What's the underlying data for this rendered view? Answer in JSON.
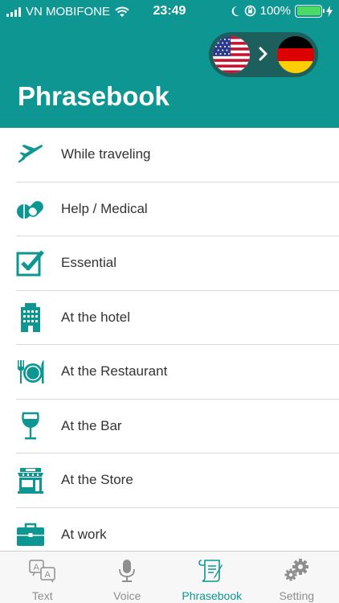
{
  "status_bar": {
    "carrier": "VN MOBIFONE",
    "time": "23:49",
    "battery": "100%"
  },
  "language_switch": {
    "from_flag": "us-flag-icon",
    "to_flag": "germany-flag-icon"
  },
  "header": {
    "title": "Phrasebook"
  },
  "categories": [
    {
      "label": "While traveling",
      "icon": "airplane-icon"
    },
    {
      "label": "Help / Medical",
      "icon": "pills-icon"
    },
    {
      "label": "Essential",
      "icon": "checkbox-icon"
    },
    {
      "label": "At the hotel",
      "icon": "hotel-icon"
    },
    {
      "label": "At the Restaurant",
      "icon": "restaurant-icon"
    },
    {
      "label": "At the Bar",
      "icon": "wine-glass-icon"
    },
    {
      "label": "At the Store",
      "icon": "store-icon"
    },
    {
      "label": "At work",
      "icon": "briefcase-icon"
    }
  ],
  "tabs": [
    {
      "label": "Text",
      "icon": "translate-text-icon",
      "active": false
    },
    {
      "label": "Voice",
      "icon": "microphone-icon",
      "active": false
    },
    {
      "label": "Phrasebook",
      "icon": "phrasebook-icon",
      "active": true
    },
    {
      "label": "Setting",
      "icon": "gears-icon",
      "active": false
    }
  ],
  "colors": {
    "primary": "#0e9692",
    "toggle_bg": "#1d5f5d",
    "battery": "#4cd964",
    "divider": "#d9d9d9",
    "tab_inactive": "#8e8e8e"
  }
}
